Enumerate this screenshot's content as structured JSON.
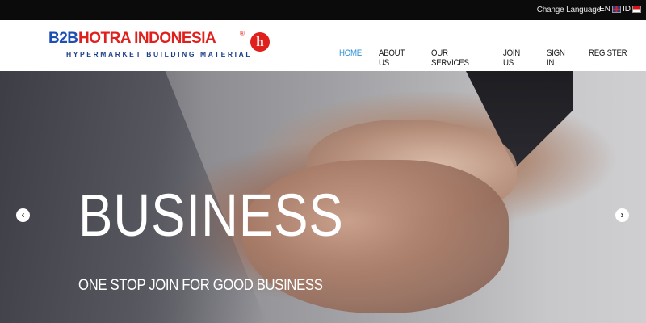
{
  "topbar": {
    "change_language": "Change Language",
    "languages": [
      {
        "code": "EN",
        "flag": "uk-flag-icon"
      },
      {
        "code": "ID",
        "flag": "id-flag-icon"
      }
    ]
  },
  "header": {
    "logo": {
      "b2b": "B2B",
      "name": "HOTRA INDONESIA",
      "reg": "®",
      "tagline": "HYPERMARKET BUILDING MATERIAL",
      "mark": "h"
    },
    "nav": [
      {
        "label": "HOME",
        "active": true
      },
      {
        "label": "ABOUT US",
        "active": false
      },
      {
        "label": "OUR SERVICES",
        "active": false
      },
      {
        "label": "JOIN US",
        "active": false
      },
      {
        "label": "SIGN IN",
        "active": false
      },
      {
        "label": "REGISTER",
        "active": false
      }
    ]
  },
  "hero": {
    "title": "BUSINESS",
    "subtitle": "ONE STOP JOIN FOR GOOD BUSINESS",
    "prev_icon": "chevron-left-icon",
    "next_icon": "chevron-right-icon"
  },
  "colors": {
    "brand_blue": "#1d4fb3",
    "brand_red": "#e0201c",
    "nav_active": "#2c8fd6",
    "topbar_bg": "#0b0b0b"
  }
}
